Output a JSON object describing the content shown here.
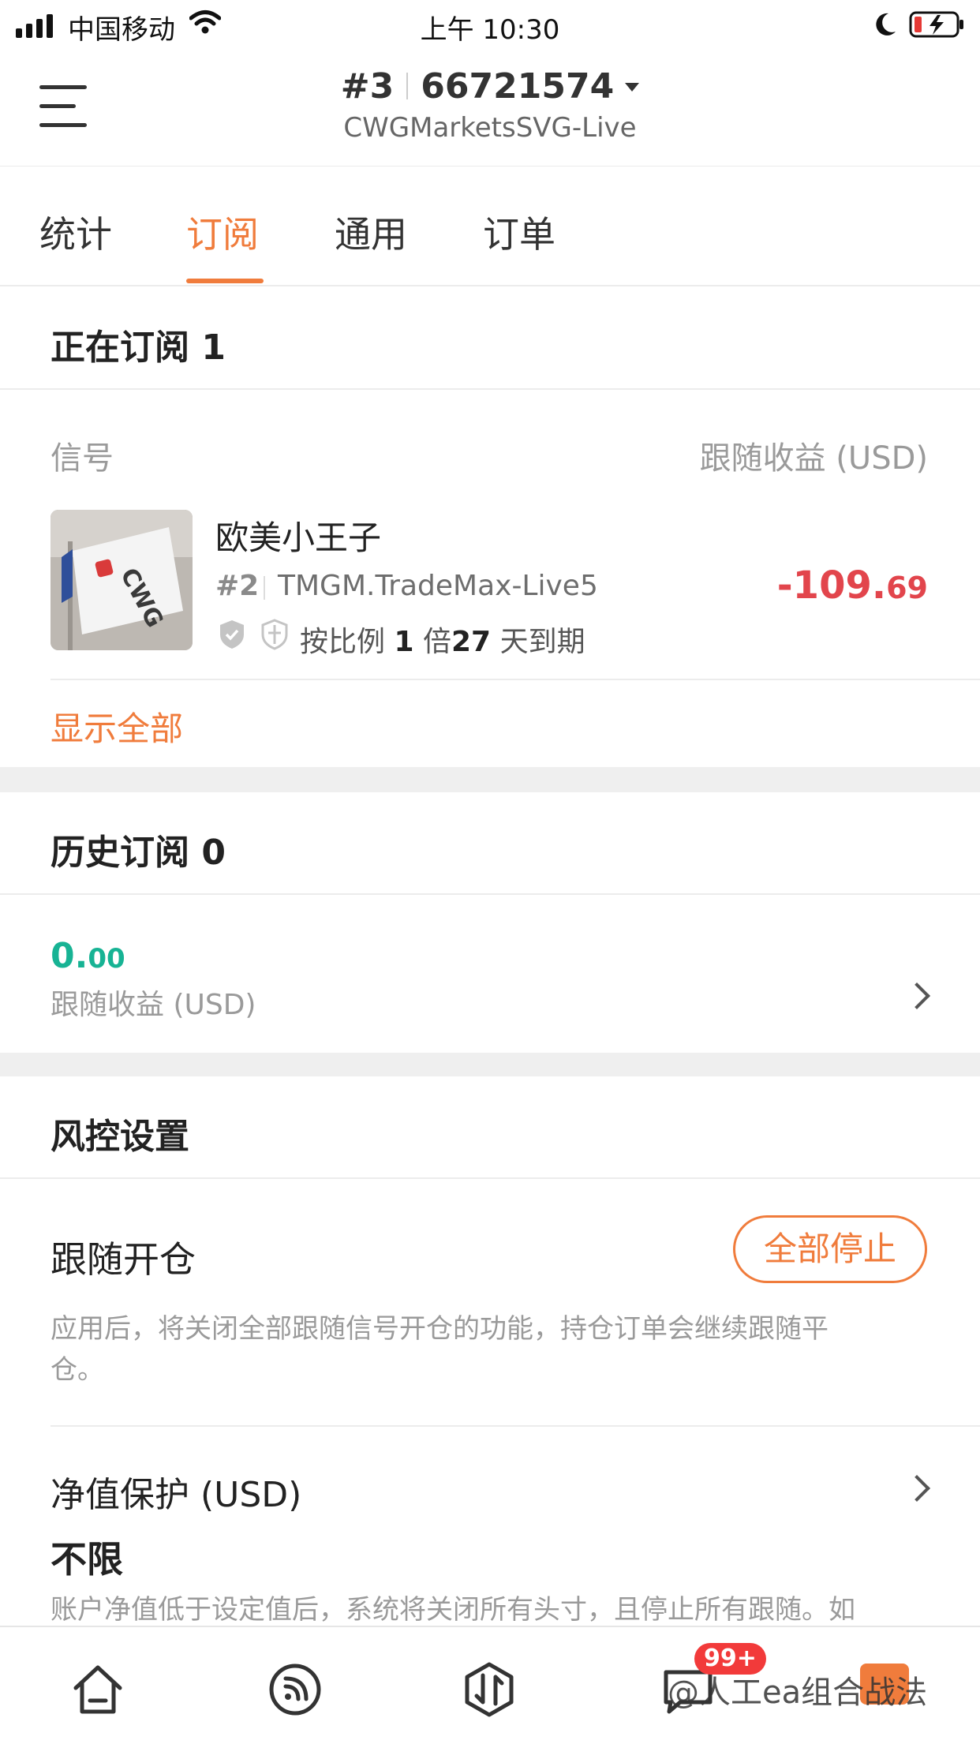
{
  "status_bar": {
    "carrier": "中国移动",
    "time": "上午 10:30"
  },
  "header": {
    "account_index": "#3",
    "account_number": "66721574",
    "server": "CWGMarketsSVG-Live"
  },
  "tabs": [
    {
      "label": "统计",
      "active": false
    },
    {
      "label": "订阅",
      "active": true
    },
    {
      "label": "通用",
      "active": false
    },
    {
      "label": "订单",
      "active": false
    }
  ],
  "current_subscriptions": {
    "title": "正在订阅 1",
    "col_signal": "信号",
    "col_profit": "跟随收益 (USD)",
    "item": {
      "thumbnail_text": "CWG",
      "name": "欧美小王子",
      "index": "#2",
      "server": "TMGM.TradeMax-Live5",
      "mode_text": "按比例",
      "ratio": "1",
      "ratio_unit": "倍",
      "days": "27",
      "days_unit": "天到期",
      "profit_main": "-109.",
      "profit_decimal": "69"
    },
    "show_all": "显示全部"
  },
  "history_subscriptions": {
    "title": "历史订阅 0",
    "value_main": "0.",
    "value_decimal": "00",
    "value_label": "跟随收益 (USD)"
  },
  "risk_control": {
    "title": "风控设置",
    "follow_open": {
      "label": "跟随开仓",
      "button": "全部停止",
      "desc_line1": "应用后，将关闭全部跟随信号开仓的功能，持仓订单会继续跟随平",
      "desc_line2": "仓。"
    },
    "equity_protection": {
      "label": "净值保护 (USD)",
      "value": "不限",
      "desc": "账户净值低于设定值后，系统将关闭所有头寸，且停止所有跟随。如"
    }
  },
  "bottom_nav": {
    "badge": "99+",
    "watermark": "@人工ea组合战法",
    "items": [
      "home-icon",
      "feed-icon",
      "trade-icon",
      "message-icon"
    ]
  },
  "colors": {
    "accent": "#f07c3c",
    "loss": "#e2454c",
    "gain": "#17b394",
    "badge": "#f23a3a"
  }
}
